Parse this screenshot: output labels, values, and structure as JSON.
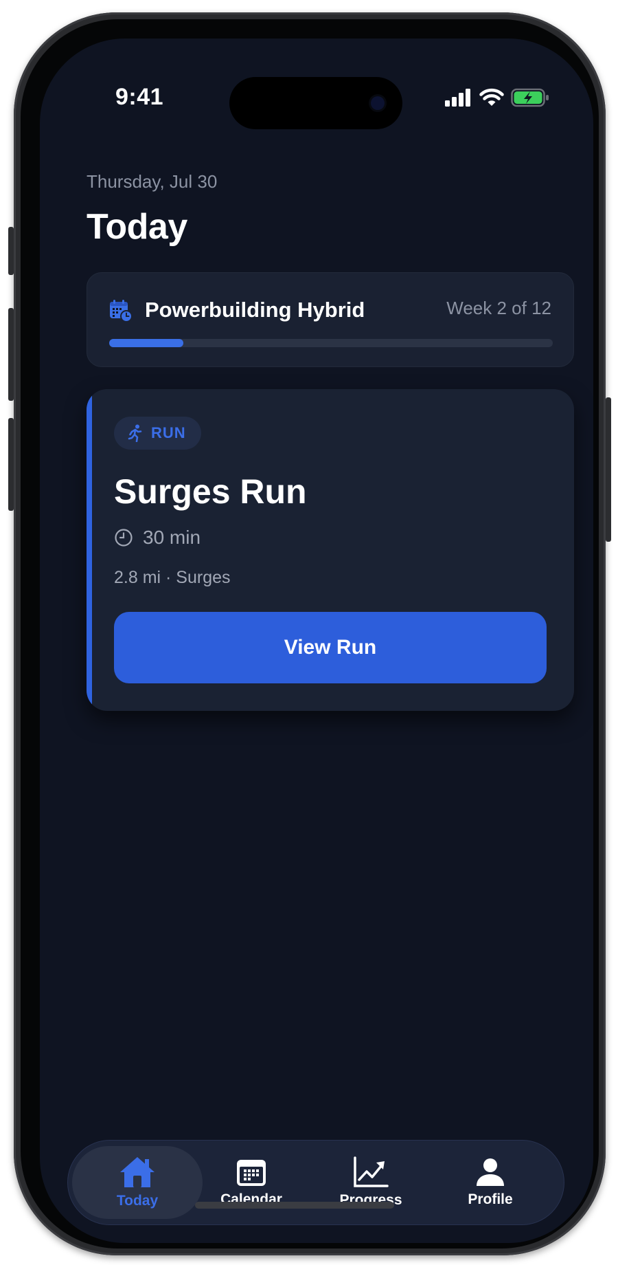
{
  "status_bar": {
    "time": "9:41"
  },
  "header": {
    "date": "Thursday, Jul 30",
    "title": "Today"
  },
  "program": {
    "name": "Powerbuilding Hybrid",
    "week_label": "Week 2 of 12",
    "progress": 0.1667,
    "icon": "calendar-clock-icon"
  },
  "workout": {
    "type_badge": "RUN",
    "type_icon": "running-person-icon",
    "title": "Surges Run",
    "duration": "30 min",
    "details": "2.8 mi · Surges",
    "cta_label": "View Run"
  },
  "tabbar": {
    "items": [
      {
        "label": "Today",
        "icon": "home-icon",
        "active": true
      },
      {
        "label": "Calendar",
        "icon": "calendar-icon",
        "active": false
      },
      {
        "label": "Progress",
        "icon": "trend-chart-icon",
        "active": false
      },
      {
        "label": "Profile",
        "icon": "person-icon",
        "active": false
      }
    ]
  },
  "colors": {
    "background": "#0f1422",
    "card": "#1a2233",
    "accent": "#2d5edb",
    "muted_text": "#8c93a3"
  }
}
